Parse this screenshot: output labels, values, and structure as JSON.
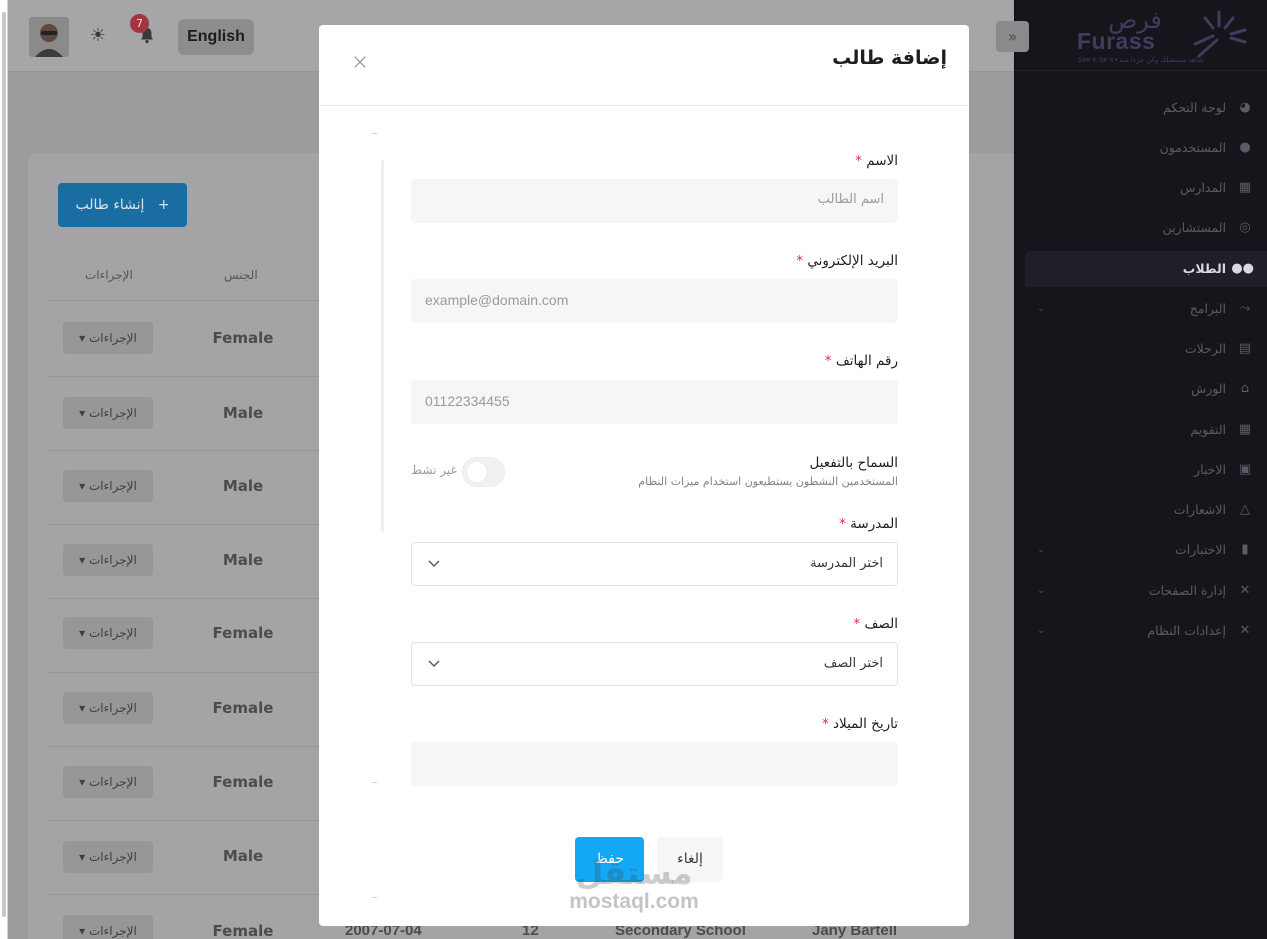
{
  "topbar": {
    "language_button": "English",
    "notification_count": "7"
  },
  "page": {
    "create_button": "إنشاء طالب",
    "create_button_icon": "+",
    "columns": [
      "الإجراءات",
      "الجنس"
    ],
    "action_label": "الإجراءات",
    "rows": [
      {
        "gender": "Female"
      },
      {
        "gender": "Male"
      },
      {
        "gender": "Male"
      },
      {
        "gender": "Male"
      },
      {
        "gender": "Female"
      },
      {
        "gender": "Female"
      },
      {
        "gender": "Female"
      },
      {
        "gender": "Male"
      },
      {
        "gender": "Female",
        "birth_date": "2007-07-04",
        "grade": "12",
        "school": "Secondary School",
        "name": "Jany Bartell"
      }
    ]
  },
  "sidebar": {
    "brand_ar": "فرص",
    "brand_en": "Furass",
    "brand_tagline": "See it. be it • شاهد مستقبلك وكن جزءا منه",
    "items": [
      {
        "label": "لوحة التحكم",
        "icon": "dashboard-icon",
        "has_submenu": false,
        "active": false
      },
      {
        "label": "المستخدمون",
        "icon": "user-icon",
        "has_submenu": false,
        "active": false
      },
      {
        "label": "المدارس",
        "icon": "school-icon",
        "has_submenu": false,
        "active": false
      },
      {
        "label": "المستشارين",
        "icon": "headset-icon",
        "has_submenu": false,
        "active": false
      },
      {
        "label": "الطلاب",
        "icon": "users-icon",
        "has_submenu": false,
        "active": true
      },
      {
        "label": "البرامج",
        "icon": "route-icon",
        "has_submenu": true,
        "active": false
      },
      {
        "label": "الرحلات",
        "icon": "map-icon",
        "has_submenu": false,
        "active": false
      },
      {
        "label": "الورش",
        "icon": "house-icon",
        "has_submenu": false,
        "active": false
      },
      {
        "label": "التقويم",
        "icon": "calendar-icon",
        "has_submenu": false,
        "active": false
      },
      {
        "label": "الاخبار",
        "icon": "newspaper-icon",
        "has_submenu": false,
        "active": false
      },
      {
        "label": "الاشعارات",
        "icon": "bell-icon",
        "has_submenu": false,
        "active": false
      },
      {
        "label": "الاختبارات",
        "icon": "clipboard-icon",
        "has_submenu": true,
        "active": false
      },
      {
        "label": "إدارة الصفحات",
        "icon": "tools-icon",
        "has_submenu": true,
        "active": false
      },
      {
        "label": "إعدادات النظام",
        "icon": "tools-icon",
        "has_submenu": true,
        "active": false
      }
    ]
  },
  "modal": {
    "title": "إضافة طالب",
    "name": {
      "label": "الاسم",
      "placeholder": "اسم الطالب",
      "value": ""
    },
    "email": {
      "label": "البريد الإلكتروني",
      "placeholder": "example@domain.com",
      "value": ""
    },
    "phone": {
      "label": "رقم الهاتف",
      "placeholder": "01122334455",
      "value": ""
    },
    "activation": {
      "label": "السماح بالتفعيل",
      "description": "المستخدمين النشطون يستطيعون استخدام ميزات النظام",
      "state_label": "غير نشط",
      "enabled": false
    },
    "school": {
      "label": "المدرسة",
      "selected": "اختر المدرسة"
    },
    "grade": {
      "label": "الصف",
      "selected": "اختر الصف"
    },
    "birth_date": {
      "label": "تاريخ الميلاد",
      "value": ""
    },
    "required_mark": "*",
    "save_button": "حفظ",
    "cancel_button": "إلغاء"
  },
  "watermark": {
    "arabic": "مستقل",
    "latin": "mostaql.com"
  },
  "colors": {
    "primary": "#14a7f3",
    "required": "#e0245e",
    "sidebar_bg": "#15151b",
    "badge": "#a2353f"
  }
}
